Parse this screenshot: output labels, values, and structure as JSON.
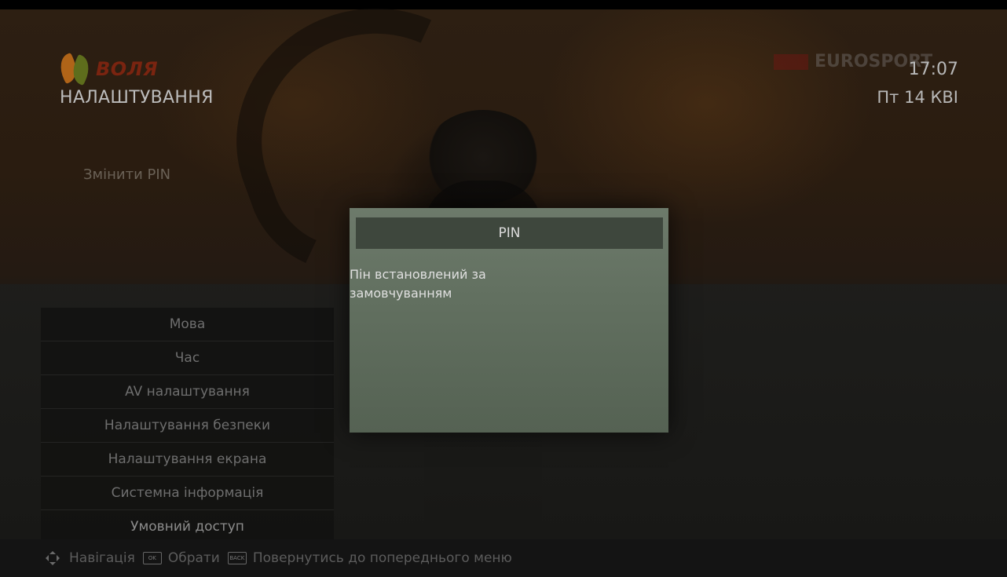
{
  "header": {
    "brand_name": "ВОЛЯ",
    "page_title": "НАЛАШТУВАННЯ",
    "channel_logo_text": "EUROSPORT",
    "clock": "17:07",
    "date": "Пт 14 КВІ"
  },
  "submenu": {
    "change_pin_label": "Змінити PIN"
  },
  "menu": {
    "items": [
      {
        "label": "Мова"
      },
      {
        "label": "Час"
      },
      {
        "label": "AV налаштування"
      },
      {
        "label": "Налаштування безпеки"
      },
      {
        "label": "Налаштування екрана"
      },
      {
        "label": "Системна інформація"
      },
      {
        "label": "Умовний доступ"
      }
    ]
  },
  "dialog": {
    "title": "PIN",
    "message_line1": "Пін встановлений за",
    "message_line2": "замовчуванням"
  },
  "footer": {
    "nav_label": "Навігація",
    "ok_key": "OK",
    "ok_label": "Обрати",
    "back_key": "BACK",
    "back_label": "Повернутись до попереднього меню"
  },
  "colors": {
    "dialog_bg": "#627060",
    "dialog_title_bg": "#3e473d",
    "brand_orange": "#b06418",
    "brand_green": "#5e6d1c"
  }
}
